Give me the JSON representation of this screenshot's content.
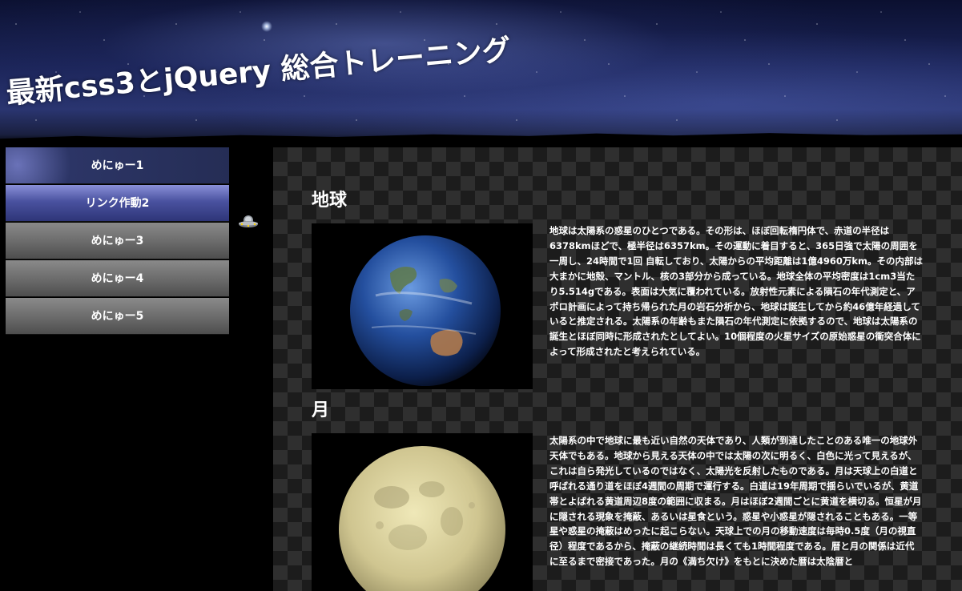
{
  "header": {
    "title": "最新css3とjQuery 総合トレーニング"
  },
  "menu": {
    "items": [
      {
        "label": "めにゅー1"
      },
      {
        "label": "リンク作動2"
      },
      {
        "label": "めにゅー3"
      },
      {
        "label": "めにゅー4"
      },
      {
        "label": "めにゅー5"
      }
    ]
  },
  "sections": [
    {
      "title": "地球",
      "text": "地球は太陽系の惑星のひとつである。その形は、ほぼ回転楕円体で、赤道の半径は6378kmほどで、極半径は6357km。その運動に着目すると、365日強で太陽の周囲を一周し、24時間で1回 自転しており、太陽からの平均距離は1億4960万km。その内部は大まかに地殻、マントル、核の3部分から成っている。地球全体の平均密度は1cm3当たり5.514gである。表面は大気に覆われている。放射性元素による隕石の年代測定と、アポロ計画によって持ち帰られた月の岩石分析から、地球は誕生してから約46億年経過していると推定される。太陽系の年齢もまた隕石の年代測定に依拠するので、地球は太陽系の誕生とほぼ同時に形成されたとしてよい。10個程度の火星サイズの原始惑星の衝突合体によって形成されたと考えられている。"
    },
    {
      "title": "月",
      "text": "太陽系の中で地球に最も近い自然の天体であり、人類が到達したことのある唯一の地球外天体でもある。地球から見える天体の中では太陽の次に明るく、白色に光って見えるが、これは自ら発光しているのではなく、太陽光を反射したものである。月は天球上の白道と呼ばれる通り道をほぼ4週間の周期で運行する。白道は19年周期で揺らいでいるが、黄道帯とよばれる黄道周辺8度の範囲に収まる。月はほぼ2週間ごとに黄道を横切る。恒星が月に隠される現象を掩蔽、あるいは星食という。惑星や小惑星が隠されることもある。一等星や惑星の掩蔽はめったに起こらない。天球上での月の移動速度は毎時0.5度（月の視直径）程度であるから、掩蔽の継続時間は長くても1時間程度である。暦と月の関係は近代に至るまで密接であった。月の《満ち欠け》をもとに決めた暦は太陰暦と"
    }
  ]
}
